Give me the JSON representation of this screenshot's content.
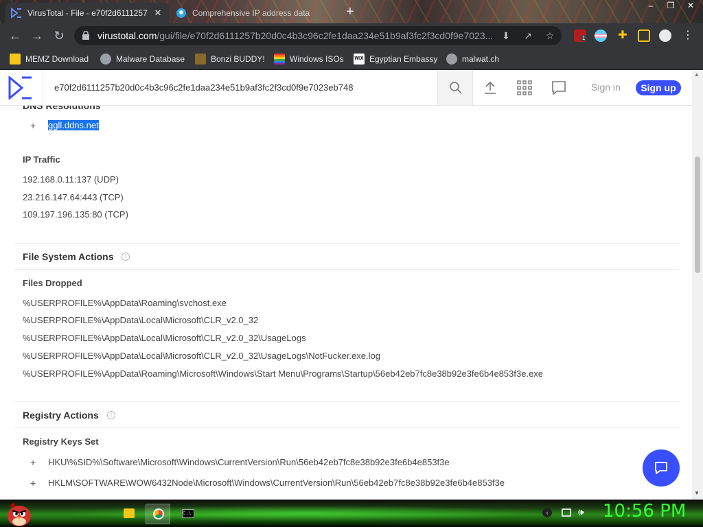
{
  "browser": {
    "tabs": [
      {
        "title": "VirusTotal - File - e70f2d6111257",
        "active": true
      },
      {
        "title": "Comprehensive IP address data",
        "active": false
      }
    ],
    "url_host": "virustotal.com",
    "url_path": "/gui/file/e70f2d6111257b20d0c4b3c96c2fe1daa234e51b9af3fc2f3cd0f9e7023...",
    "extension_badge": "1",
    "bookmarks": [
      {
        "label": "MEMZ Download",
        "icon": "memz-icon",
        "color": "#f5c518"
      },
      {
        "label": "Malware Database",
        "icon": "globe-icon",
        "color": "#9aa0a6"
      },
      {
        "label": "Bonzi BUDDY!",
        "icon": "bonzi-icon",
        "color": "#8a6a2a"
      },
      {
        "label": "Windows ISOs",
        "icon": "rainbow-flag-icon",
        "color": "#e53935"
      },
      {
        "label": "Egyptian Embassy",
        "icon": "wix-icon",
        "color": "#ffffff"
      },
      {
        "label": "malwat.ch",
        "icon": "globe-icon",
        "color": "#9aa0a6"
      }
    ]
  },
  "vt": {
    "search_value": "e70f2d6111257b20d0c4b3c96c2fe1daa234e51b9af3fc2f3cd0f9e7023eb748",
    "sign_in": "Sign in",
    "sign_up": "Sign up",
    "accent": "#394eff"
  },
  "content": {
    "dns_heading_partial": "DNS Resolutions",
    "dns_items": [
      "ggll.ddns.net"
    ],
    "ip_traffic_heading": "IP Traffic",
    "ip_traffic": [
      "192.168.0.11:137 (UDP)",
      "23.216.147.64:443 (TCP)",
      "109.197.196.135:80 (TCP)"
    ],
    "fs_heading": "File System Actions",
    "files_dropped_heading": "Files Dropped",
    "files_dropped": [
      "%USERPROFILE%\\AppData\\Roaming\\svchost.exe",
      "%USERPROFILE%\\AppData\\Local\\Microsoft\\CLR_v2.0_32",
      "%USERPROFILE%\\AppData\\Local\\Microsoft\\CLR_v2.0_32\\UsageLogs",
      "%USERPROFILE%\\AppData\\Local\\Microsoft\\CLR_v2.0_32\\UsageLogs\\NotFucker.exe.log",
      "%USERPROFILE%\\AppData\\Roaming\\Microsoft\\Windows\\Start Menu\\Programs\\Startup\\56eb42eb7fc8e38b92e3fe6b4e853f3e.exe"
    ],
    "registry_heading": "Registry Actions",
    "registry_keys_heading": "Registry Keys Set",
    "registry_keys": [
      "HKU\\%SID%\\Software\\Microsoft\\Windows\\CurrentVersion\\Run\\56eb42eb7fc8e38b92e3fe6b4e853f3e",
      "HKLM\\SOFTWARE\\WOW6432Node\\Microsoft\\Windows\\CurrentVersion\\Run\\56eb42eb7fc8e38b92e3fe6b4e853f3e"
    ]
  },
  "taskbar": {
    "clock": "10:56 PM",
    "clock_color": "#33ff33"
  }
}
